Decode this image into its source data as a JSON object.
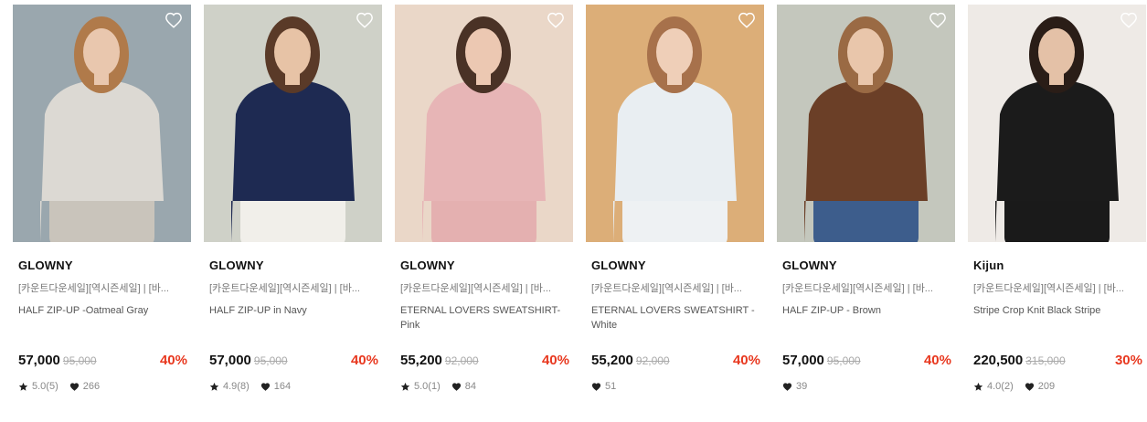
{
  "products": [
    {
      "brand": "GLOWNY",
      "promo": "[카운트다운세일][역시즌세일] | [바...",
      "name": "HALF ZIP-UP -Oatmeal Gray",
      "price": "57,000",
      "original_price": "95,000",
      "discount": "40%",
      "rating": "5.0(5)",
      "likes": "266",
      "image": {
        "bg": "#9aa7ae",
        "top": "#dcd9d3",
        "bottom": "#c9c4bb",
        "hair": "#b07a4a",
        "skin": "#e9c7ae"
      }
    },
    {
      "brand": "GLOWNY",
      "promo": "[카운트다운세일][역시즌세일] | [바...",
      "name": "HALF ZIP-UP in Navy",
      "price": "57,000",
      "original_price": "95,000",
      "discount": "40%",
      "rating": "4.9(8)",
      "likes": "164",
      "image": {
        "bg": "#cfd1c8",
        "top": "#1e2a52",
        "bottom": "#f1efea",
        "hair": "#5a3a28",
        "skin": "#e7c3a6"
      }
    },
    {
      "brand": "GLOWNY",
      "promo": "[카운트다운세일][역시즌세일] | [바...",
      "name": "ETERNAL LOVERS SWEATSHIRT- Pink",
      "price": "55,200",
      "original_price": "92,000",
      "discount": "40%",
      "rating": "5.0(1)",
      "likes": "84",
      "image": {
        "bg": "#ead7c8",
        "top": "#e7b5b6",
        "bottom": "#e4b0b0",
        "hair": "#4a3226",
        "skin": "#ecc8b2"
      }
    },
    {
      "brand": "GLOWNY",
      "promo": "[카운트다운세일][역시즌세일] | [바...",
      "name": "ETERNAL LOVERS SWEATSHIRT - White",
      "price": "55,200",
      "original_price": "92,000",
      "discount": "40%",
      "rating": "",
      "likes": "51",
      "image": {
        "bg": "#dcae78",
        "top": "#e9eef2",
        "bottom": "#eef1f3",
        "hair": "#a7714b",
        "skin": "#efcfb8"
      }
    },
    {
      "brand": "GLOWNY",
      "promo": "[카운트다운세일][역시즌세일] | [바...",
      "name": "HALF ZIP-UP - Brown",
      "price": "57,000",
      "original_price": "95,000",
      "discount": "40%",
      "rating": "",
      "likes": "39",
      "image": {
        "bg": "#c4c7bd",
        "top": "#6b3f27",
        "bottom": "#3d5d8c",
        "hair": "#9a6a44",
        "skin": "#e9c6ab"
      }
    },
    {
      "brand": "Kijun",
      "promo": "[카운트다운세일][역시즌세일] | [바...",
      "name": "Stripe Crop Knit Black Stripe",
      "price": "220,500",
      "original_price": "315,000",
      "discount": "30%",
      "rating": "4.0(2)",
      "likes": "209",
      "image": {
        "bg": "#eeeae6",
        "top": "#1b1b1b",
        "bottom": "#1a1a1a",
        "hair": "#2a1d17",
        "skin": "#e4c1a7"
      }
    }
  ],
  "colors": {
    "discount": "#e8381f",
    "text": "#111111",
    "muted": "#888888"
  },
  "icons": {
    "wishlist": "heart-outline-icon",
    "rating": "star-icon",
    "likes": "heart-icon"
  }
}
